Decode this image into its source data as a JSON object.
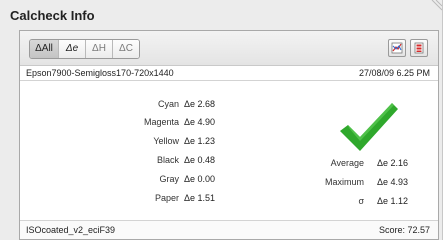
{
  "window": {
    "title": "Calcheck Info"
  },
  "toolbar": {
    "tabs": [
      {
        "label": "ΔAll",
        "active": true
      },
      {
        "label": "Δe",
        "active": false
      },
      {
        "label": "ΔH",
        "active": false
      },
      {
        "label": "ΔC",
        "active": false
      }
    ]
  },
  "header": {
    "profile": "Epson7900-Semigloss170-720x1440",
    "date": "27/08/09 6.25 PM"
  },
  "metrics": [
    {
      "label": "Cyan",
      "value": "Δe 2.68"
    },
    {
      "label": "Magenta",
      "value": "Δe 4.90"
    },
    {
      "label": "Yellow",
      "value": "Δe 1.23"
    },
    {
      "label": "Black",
      "value": "Δe 0.48"
    },
    {
      "label": "Gray",
      "value": "Δe 0.00"
    },
    {
      "label": "Paper",
      "value": "Δe 1.51"
    }
  ],
  "summary": [
    {
      "label": "Average",
      "value": "Δe 2.16"
    },
    {
      "label": "Maximum",
      "value": "Δe 4.93"
    },
    {
      "label": "σ",
      "value": "Δe 1.12"
    }
  ],
  "footer": {
    "reference": "ISOcoated_v2_eciF39",
    "score": "Score: 72.57"
  },
  "colors": {
    "check": "#2fa82c",
    "accent_red": "#d42b2b"
  }
}
